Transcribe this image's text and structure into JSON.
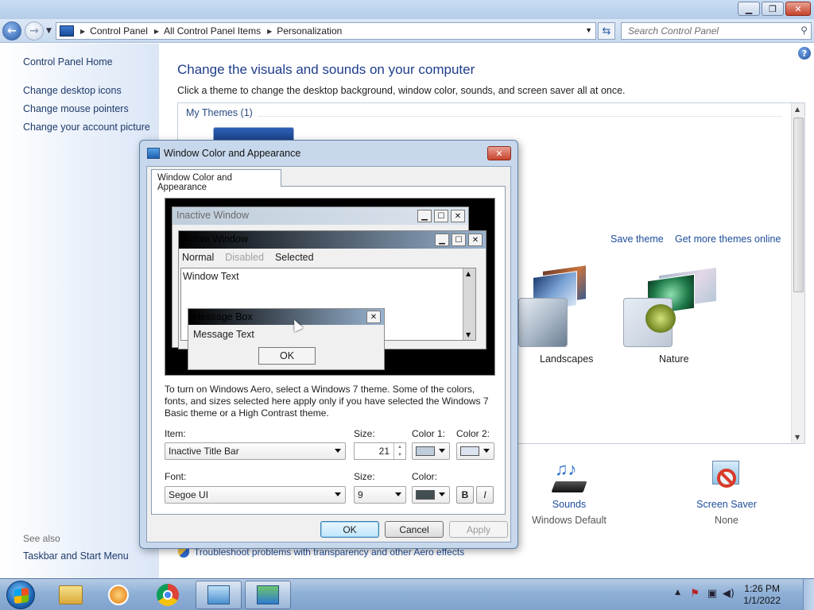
{
  "window": {
    "caption_buttons": {
      "minimize": "▁",
      "maximize": "❐",
      "close": "✕"
    }
  },
  "navbar": {
    "breadcrumb": [
      "Control Panel",
      "All Control Panel Items",
      "Personalization"
    ],
    "search_placeholder": "Search Control Panel"
  },
  "leftpane": {
    "home": "Control Panel Home",
    "links": [
      "Change desktop icons",
      "Change mouse pointers",
      "Change your account picture"
    ],
    "see_also": "See also",
    "see_also_links": [
      "Taskbar and Start Menu"
    ]
  },
  "main": {
    "heading": "Change the visuals and sounds on your computer",
    "subtext": "Click a theme to change the desktop background, window color, sounds, and screen saver all at once.",
    "my_themes": "My Themes (1)",
    "save_theme": "Save theme",
    "get_more": "Get more themes online",
    "themes": [
      {
        "name": "Landscapes"
      },
      {
        "name": "Nature"
      }
    ],
    "bottom": [
      {
        "title": "Sounds",
        "subtitle": "Windows Default",
        "icon": "sounds-icon"
      },
      {
        "title": "Screen Saver",
        "subtitle": "None",
        "icon": "screensaver-icon"
      }
    ],
    "troubleshoot": "Troubleshoot problems with transparency and other Aero effects"
  },
  "dialog": {
    "title": "Window Color and Appearance",
    "tab": "Window Color and Appearance",
    "preview": {
      "inactive_title": "Inactive Window",
      "active_title": "Active Window",
      "menu": [
        "Normal",
        "Disabled",
        "Selected"
      ],
      "window_text": "Window Text",
      "msgbox_title": "Message Box",
      "msgbox_text": "Message Text",
      "ok": "OK"
    },
    "description": "To turn on Windows Aero, select a Windows 7 theme.  Some of the colors, fonts, and sizes selected here apply only if you have selected the Windows 7 Basic theme or a High Contrast theme.",
    "item_label": "Item:",
    "item_value": "Inactive Title Bar",
    "size_label": "Size:",
    "size_value": "21",
    "color1_label": "Color 1:",
    "color2_label": "Color 2:",
    "font_label": "Font:",
    "font_value": "Segoe UI",
    "font_size_label": "Size:",
    "font_size_value": "9",
    "color_label": "Color:",
    "bold": "B",
    "italic": "I",
    "buttons": {
      "ok": "OK",
      "cancel": "Cancel",
      "apply": "Apply"
    },
    "colors": {
      "color1": "#bfcddb",
      "color2": "#dbe4ee",
      "font_color": "#434e54"
    }
  },
  "taskbar": {
    "time": "1:26 PM",
    "date": "1/1/2022"
  }
}
